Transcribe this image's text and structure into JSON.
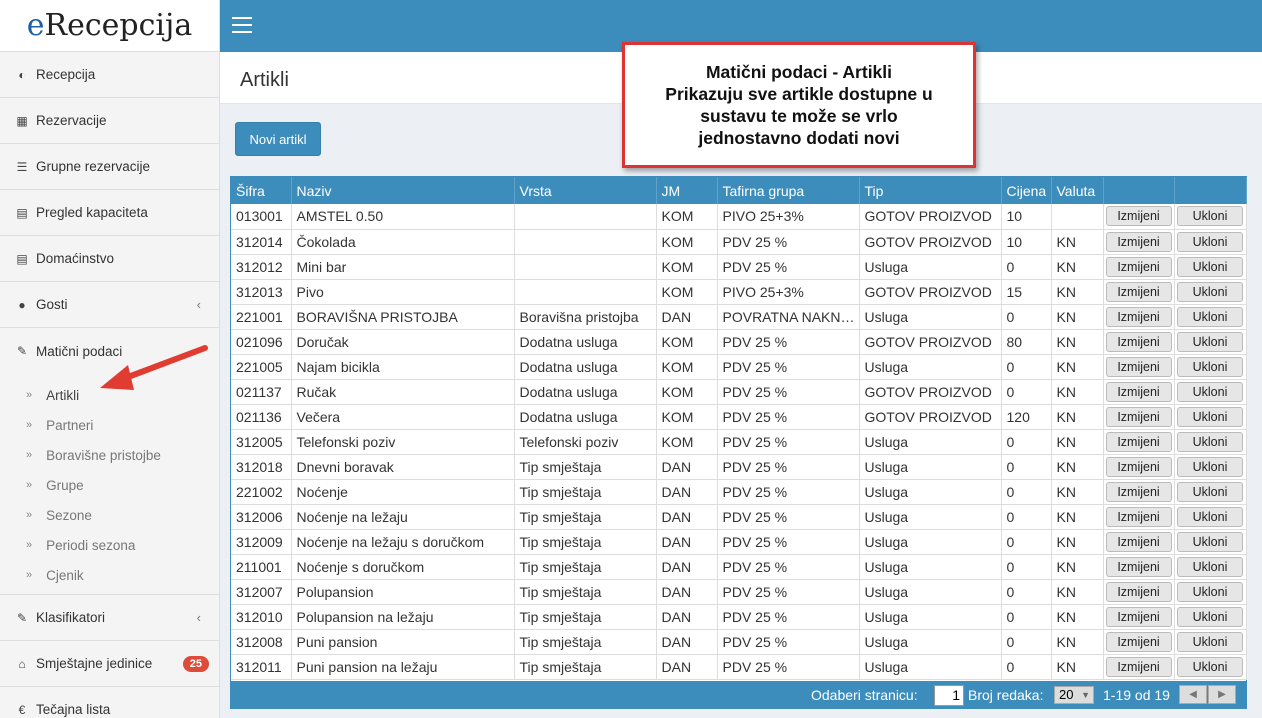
{
  "app": {
    "logo_e": "e",
    "logo_rest": "Recepcija"
  },
  "sidebar": {
    "items": [
      {
        "label": "Recepcija",
        "icon": "dashboard-icon"
      },
      {
        "label": "Rezervacije",
        "icon": "grid-icon"
      },
      {
        "label": "Grupne rezervacije",
        "icon": "list-icon"
      },
      {
        "label": "Pregled kapaciteta",
        "icon": "calendar-icon"
      },
      {
        "label": "Domaćinstvo",
        "icon": "list-alt-icon"
      },
      {
        "label": "Gosti",
        "icon": "users-icon"
      },
      {
        "label": "Matični podaci",
        "icon": "edit-icon"
      }
    ],
    "submenu": [
      "Artikli",
      "Partneri",
      "Boravišne pristojbe",
      "Grupe",
      "Sezone",
      "Periodi sezona",
      "Cjenik"
    ],
    "items2": [
      {
        "label": "Klasifikatori",
        "icon": "edit-icon"
      },
      {
        "label": "Smještajne jedinice",
        "icon": "home-icon",
        "badge": "25"
      },
      {
        "label": "Tečajna lista",
        "icon": "euro-icon"
      }
    ]
  },
  "page": {
    "title": "Artikli",
    "new_button": "Novi artikl"
  },
  "callout": {
    "line1": "Matični podaci - Artikli",
    "line2": "Prikazuju sve artikle dostupne u",
    "line3": "sustavu te može se vrlo",
    "line4": "jednostavno dodati novi"
  },
  "table": {
    "headers": [
      "Šifra",
      "Naziv",
      "Vrsta",
      "JM",
      "Tafirna grupa",
      "Tip",
      "Cijena",
      "Valuta",
      "",
      ""
    ],
    "edit_label": "Izmijeni",
    "delete_label": "Ukloni",
    "rows": [
      [
        "013001",
        "AMSTEL 0.50",
        "",
        "KOM",
        "PIVO 25+3%",
        "GOTOV PROIZVOD",
        "10",
        ""
      ],
      [
        "312014",
        "Čokolada",
        "",
        "KOM",
        "PDV 25 %",
        "GOTOV PROIZVOD",
        "10",
        "KN"
      ],
      [
        "312012",
        "Mini bar",
        "",
        "KOM",
        "PDV 25 %",
        "Usluga",
        "0",
        "KN"
      ],
      [
        "312013",
        "Pivo",
        "",
        "KOM",
        "PIVO 25+3%",
        "GOTOV PROIZVOD",
        "15",
        "KN"
      ],
      [
        "221001",
        "BORAVIŠNA PRISTOJBA",
        "Boravišna pristojba",
        "DAN",
        "POVRATNA NAKNADA",
        "Usluga",
        "0",
        "KN"
      ],
      [
        "021096",
        "Doručak",
        "Dodatna usluga",
        "KOM",
        "PDV 25 %",
        "GOTOV PROIZVOD",
        "80",
        "KN"
      ],
      [
        "221005",
        "Najam bicikla",
        "Dodatna usluga",
        "KOM",
        "PDV 25 %",
        "Usluga",
        "0",
        "KN"
      ],
      [
        "021137",
        "Ručak",
        "Dodatna usluga",
        "KOM",
        "PDV 25 %",
        "GOTOV PROIZVOD",
        "0",
        "KN"
      ],
      [
        "021136",
        "Večera",
        "Dodatna usluga",
        "KOM",
        "PDV 25 %",
        "GOTOV PROIZVOD",
        "120",
        "KN"
      ],
      [
        "312005",
        "Telefonski poziv",
        "Telefonski poziv",
        "KOM",
        "PDV 25 %",
        "Usluga",
        "0",
        "KN"
      ],
      [
        "312018",
        "Dnevni boravak",
        "Tip smještaja",
        "DAN",
        "PDV 25 %",
        "Usluga",
        "0",
        "KN"
      ],
      [
        "221002",
        "Noćenje",
        "Tip smještaja",
        "DAN",
        "PDV 25 %",
        "Usluga",
        "0",
        "KN"
      ],
      [
        "312006",
        "Noćenje na ležaju",
        "Tip smještaja",
        "DAN",
        "PDV 25 %",
        "Usluga",
        "0",
        "KN"
      ],
      [
        "312009",
        "Noćenje na ležaju s doručkom",
        "Tip smještaja",
        "DAN",
        "PDV 25 %",
        "Usluga",
        "0",
        "KN"
      ],
      [
        "211001",
        "Noćenje s doručkom",
        "Tip smještaja",
        "DAN",
        "PDV 25 %",
        "Usluga",
        "0",
        "KN"
      ],
      [
        "312007",
        "Polupansion",
        "Tip smještaja",
        "DAN",
        "PDV 25 %",
        "Usluga",
        "0",
        "KN"
      ],
      [
        "312010",
        "Polupansion na ležaju",
        "Tip smještaja",
        "DAN",
        "PDV 25 %",
        "Usluga",
        "0",
        "KN"
      ],
      [
        "312008",
        "Puni pansion",
        "Tip smještaja",
        "DAN",
        "PDV 25 %",
        "Usluga",
        "0",
        "KN"
      ],
      [
        "312011",
        "Puni pansion na ležaju",
        "Tip smještaja",
        "DAN",
        "PDV 25 %",
        "Usluga",
        "0",
        "KN"
      ]
    ]
  },
  "pager": {
    "page_label": "Odaberi stranicu:",
    "page_value": "1",
    "rows_label": "Broj redaka:",
    "rows_value": "20",
    "range": "1-19 od 19"
  },
  "colors": {
    "accent": "#3c8dbc",
    "callout_border": "#dd3333",
    "badge": "#dd4b39"
  }
}
